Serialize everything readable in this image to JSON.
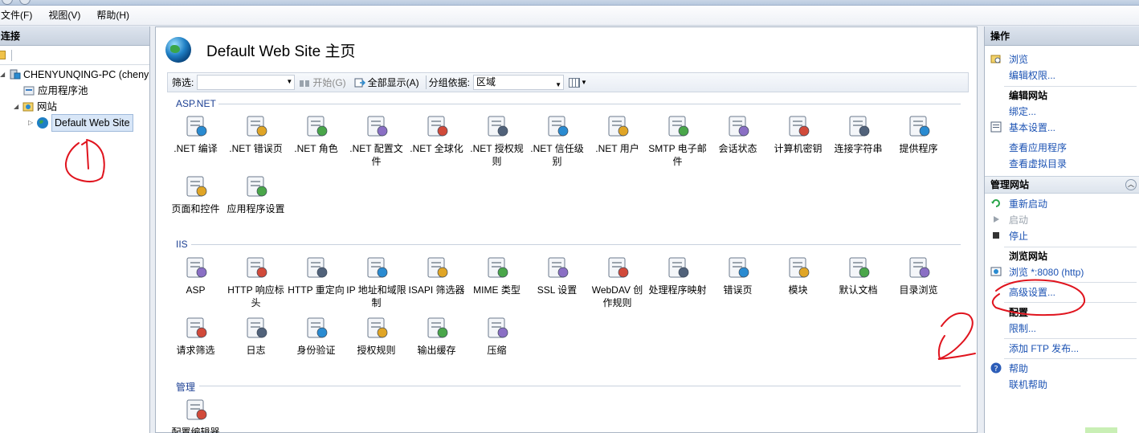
{
  "menu": [
    "文件(F)",
    "视图(V)",
    "帮助(H)"
  ],
  "connections": {
    "header": "连接",
    "tree": [
      {
        "label": "CHENYUNQING-PC (cheny",
        "icon": "server-icon"
      },
      {
        "label": "应用程序池",
        "icon": "app-pool-icon"
      },
      {
        "label": "网站",
        "icon": "sites-folder-icon"
      },
      {
        "label": "Default Web Site",
        "icon": "globe-icon"
      }
    ]
  },
  "main": {
    "title": "Default Web Site 主页",
    "filter": {
      "label": "筛选:",
      "start": "开始(G)",
      "show_all": "全部显示(A)",
      "group_by_label": "分组依据:",
      "group_by_value": "区域"
    },
    "sections": [
      {
        "name": "ASP.NET",
        "items": [
          ".NET 编译",
          ".NET 错误页",
          ".NET 角色",
          ".NET 配置文件",
          ".NET 全球化",
          ".NET 授权规则",
          ".NET 信任级别",
          ".NET 用户",
          "SMTP 电子邮件",
          "会话状态",
          "计算机密钥",
          "连接字符串",
          "提供程序",
          "页面和控件",
          "应用程序设置"
        ]
      },
      {
        "name": "IIS",
        "items": [
          "ASP",
          "HTTP 响应标头",
          "HTTP 重定向",
          "IP 地址和域限制",
          "ISAPI 筛选器",
          "MIME 类型",
          "SSL 设置",
          "WebDAV 创作规则",
          "处理程序映射",
          "错误页",
          "模块",
          "默认文档",
          "目录浏览",
          "请求筛选",
          "日志",
          "身份验证",
          "授权规则",
          "输出缓存",
          "压缩"
        ]
      },
      {
        "name": "管理",
        "items": [
          "配置编辑器"
        ]
      }
    ]
  },
  "actions": {
    "header": "操作",
    "browse": "浏览",
    "edit_perms": "编辑权限...",
    "edit_site": "编辑网站",
    "bindings": "绑定...",
    "basic_settings": "基本设置...",
    "view_apps": "查看应用程序",
    "view_vdirs": "查看虚拟目录",
    "manage_site": "管理网站",
    "restart": "重新启动",
    "start": "启动",
    "stop": "停止",
    "browse_site": "浏览网站",
    "browse_8080": "浏览 *:8080 (http)",
    "advanced_settings": "高级设置...",
    "config": "配置",
    "limits": "限制...",
    "add_ftp": "添加 FTP 发布...",
    "help": "帮助",
    "online_help": "联机帮助"
  },
  "annotations": {
    "mark1": "1",
    "mark2": "2",
    "color": "#e0141e"
  }
}
